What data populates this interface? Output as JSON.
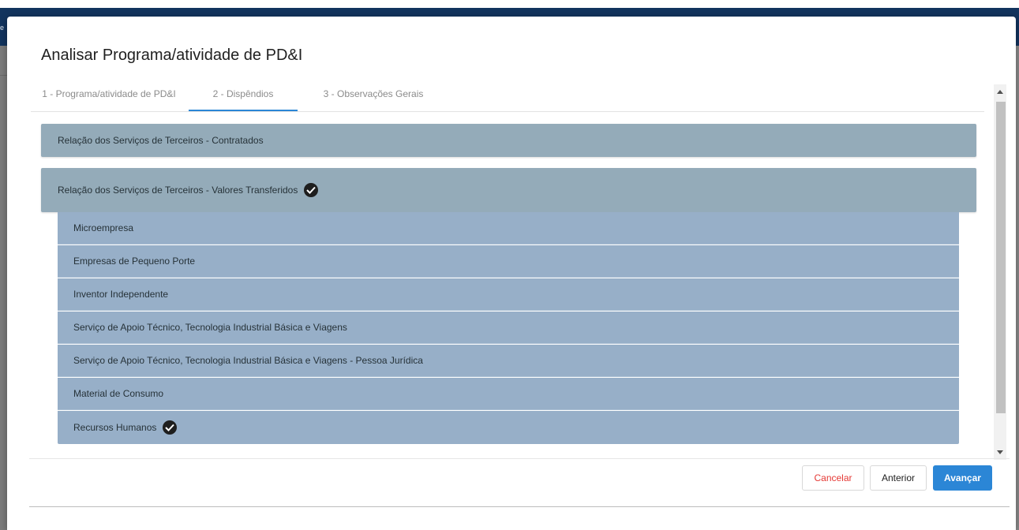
{
  "modal": {
    "title": "Analisar Programa/atividade de PD&I"
  },
  "tabs": [
    {
      "label": "1 - Programa/atividade de PD&I",
      "active": false
    },
    {
      "label": "2 - Dispêndios",
      "active": true
    },
    {
      "label": "3 - Observações Gerais",
      "active": false
    }
  ],
  "panels": [
    {
      "label": "Relação dos Serviços de Terceiros - Contratados",
      "checked": false,
      "expanded": false
    },
    {
      "label": "Relação dos Serviços de Terceiros - Valores Transferidos",
      "checked": true,
      "expanded": true
    }
  ],
  "sub_items": [
    {
      "label": "Microempresa",
      "checked": false
    },
    {
      "label": "Empresas de Pequeno Porte",
      "checked": false
    },
    {
      "label": "Inventor Independente",
      "checked": false
    },
    {
      "label": "Serviço de Apoio Técnico, Tecnologia Industrial Básica e Viagens",
      "checked": false
    },
    {
      "label": "Serviço de Apoio Técnico, Tecnologia Industrial Básica e Viagens - Pessoa Jurídica",
      "checked": false
    },
    {
      "label": "Material de Consumo",
      "checked": false
    },
    {
      "label": "Recursos Humanos",
      "checked": true
    }
  ],
  "buttons": {
    "cancel": "Cancelar",
    "previous": "Anterior",
    "next": "Avançar"
  },
  "background": {
    "cut_text": "e"
  },
  "colors": {
    "navbar": "#12345e",
    "panel_header": "#94abb9",
    "sub_item": "#97afc8",
    "accent": "#2b86d6",
    "cancel_text": "#e53935"
  },
  "icons": {
    "check": "check-circle-icon"
  }
}
